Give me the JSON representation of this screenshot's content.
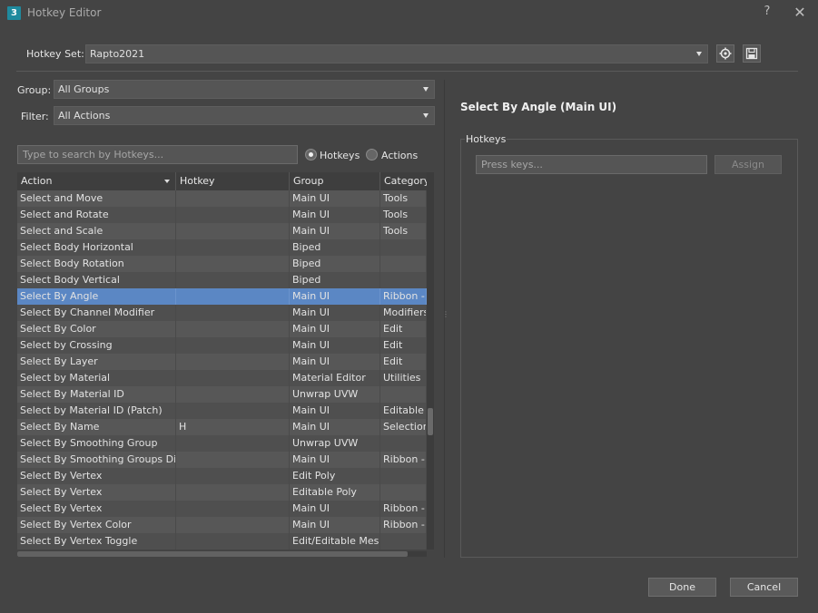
{
  "window": {
    "title": "Hotkey Editor",
    "help": "?",
    "close": "✕"
  },
  "hotkey_set": {
    "label": "Hotkey Set:",
    "value": "Rapto2021"
  },
  "group": {
    "label": "Group:",
    "value": "All Groups"
  },
  "filter": {
    "label": "Filter:",
    "value": "All Actions"
  },
  "search": {
    "placeholder": "Type to search by Hotkeys..."
  },
  "radios": {
    "hotkeys": "Hotkeys",
    "actions": "Actions"
  },
  "table": {
    "headers": [
      "Action",
      "Hotkey",
      "Group",
      "Category"
    ],
    "rows": [
      [
        "Select and Move",
        "",
        "Main UI",
        "Tools"
      ],
      [
        "Select and Rotate",
        "",
        "Main UI",
        "Tools"
      ],
      [
        "Select and Scale",
        "",
        "Main UI",
        "Tools"
      ],
      [
        "Select Body Horizontal",
        "",
        "Biped",
        ""
      ],
      [
        "Select Body Rotation",
        "",
        "Biped",
        ""
      ],
      [
        "Select Body Vertical",
        "",
        "Biped",
        ""
      ],
      [
        "Select By Angle",
        "",
        "Main UI",
        "Ribbon - M"
      ],
      [
        "Select By Channel Modifier",
        "",
        "Main UI",
        "Modifiers"
      ],
      [
        "Select By Color",
        "",
        "Main UI",
        "Edit"
      ],
      [
        "Select by Crossing",
        "",
        "Main UI",
        "Edit"
      ],
      [
        "Select By Layer",
        "",
        "Main UI",
        "Edit"
      ],
      [
        "Select by Material",
        "",
        "Material Editor",
        "Utilities"
      ],
      [
        "Select By Material ID",
        "",
        "Unwrap UVW",
        ""
      ],
      [
        "Select by Material ID (Patch)",
        "",
        "Main UI",
        "Editable P"
      ],
      [
        "Select By Name",
        "H",
        "Main UI",
        "Selection"
      ],
      [
        "Select By Smoothing Group",
        "",
        "Unwrap UVW",
        ""
      ],
      [
        "Select By Smoothing Groups Dialog",
        "",
        "Main UI",
        "Ribbon - M"
      ],
      [
        "Select By Vertex",
        "",
        "Edit Poly",
        ""
      ],
      [
        "Select By Vertex",
        "",
        "Editable Poly",
        ""
      ],
      [
        "Select By Vertex",
        "",
        "Main UI",
        "Ribbon - M"
      ],
      [
        "Select By Vertex Color",
        "",
        "Main UI",
        "Ribbon - M"
      ],
      [
        "Select By Vertex Toggle",
        "",
        "Edit/Editable Mesh",
        ""
      ]
    ],
    "selected_index": 6
  },
  "detail": {
    "title": "Select By Angle (Main UI)",
    "group_label": "Hotkeys",
    "press_keys_placeholder": "Press keys...",
    "assign_label": "Assign"
  },
  "footer": {
    "done": "Done",
    "cancel": "Cancel"
  },
  "colors": {
    "accent_selection": "#5b87c4",
    "background": "#444444"
  }
}
